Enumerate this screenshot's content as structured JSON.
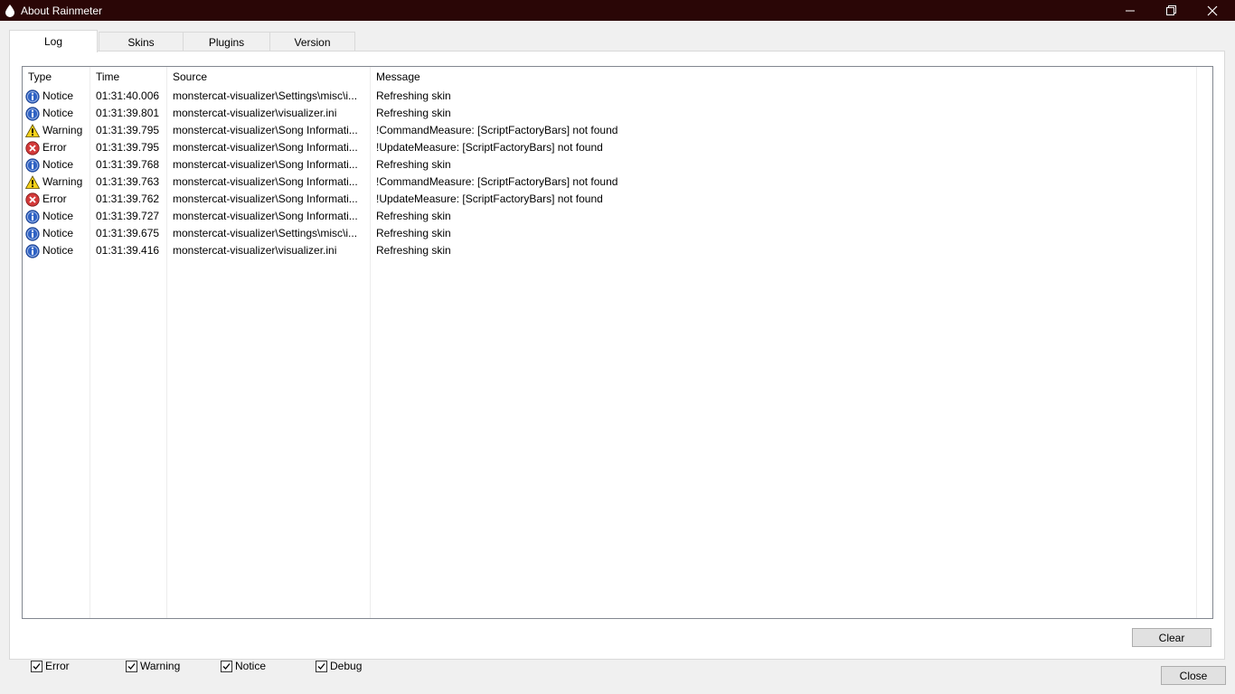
{
  "window": {
    "title": "About Rainmeter",
    "titlebar_color": "#2a0606"
  },
  "tabs": [
    {
      "label": "Log",
      "active": true
    },
    {
      "label": "Skins",
      "active": false
    },
    {
      "label": "Plugins",
      "active": false
    },
    {
      "label": "Version",
      "active": false
    }
  ],
  "log": {
    "columns": [
      "Type",
      "Time",
      "Source",
      "Message"
    ],
    "rows": [
      {
        "type": "Notice",
        "icon": "info-icon",
        "time": "01:31:40.006",
        "source": "monstercat-visualizer\\Settings\\misc\\i...",
        "message": "Refreshing skin"
      },
      {
        "type": "Notice",
        "icon": "info-icon",
        "time": "01:31:39.801",
        "source": "monstercat-visualizer\\visualizer.ini",
        "message": "Refreshing skin"
      },
      {
        "type": "Warning",
        "icon": "warning-icon",
        "time": "01:31:39.795",
        "source": "monstercat-visualizer\\Song Informati...",
        "message": "!CommandMeasure: [ScriptFactoryBars] not found"
      },
      {
        "type": "Error",
        "icon": "error-icon",
        "time": "01:31:39.795",
        "source": "monstercat-visualizer\\Song Informati...",
        "message": "!UpdateMeasure: [ScriptFactoryBars] not found"
      },
      {
        "type": "Notice",
        "icon": "info-icon",
        "time": "01:31:39.768",
        "source": "monstercat-visualizer\\Song Informati...",
        "message": "Refreshing skin"
      },
      {
        "type": "Warning",
        "icon": "warning-icon",
        "time": "01:31:39.763",
        "source": "monstercat-visualizer\\Song Informati...",
        "message": "!CommandMeasure: [ScriptFactoryBars] not found"
      },
      {
        "type": "Error",
        "icon": "error-icon",
        "time": "01:31:39.762",
        "source": "monstercat-visualizer\\Song Informati...",
        "message": "!UpdateMeasure: [ScriptFactoryBars] not found"
      },
      {
        "type": "Notice",
        "icon": "info-icon",
        "time": "01:31:39.727",
        "source": "monstercat-visualizer\\Song Informati...",
        "message": "Refreshing skin"
      },
      {
        "type": "Notice",
        "icon": "info-icon",
        "time": "01:31:39.675",
        "source": "monstercat-visualizer\\Settings\\misc\\i...",
        "message": "Refreshing skin"
      },
      {
        "type": "Notice",
        "icon": "info-icon",
        "time": "01:31:39.416",
        "source": "monstercat-visualizer\\visualizer.ini",
        "message": "Refreshing skin"
      }
    ]
  },
  "filters": [
    {
      "label": "Error",
      "checked": true
    },
    {
      "label": "Warning",
      "checked": true
    },
    {
      "label": "Notice",
      "checked": true
    },
    {
      "label": "Debug",
      "checked": true
    }
  ],
  "buttons": {
    "clear_label": "Clear",
    "close_label": "Close"
  }
}
